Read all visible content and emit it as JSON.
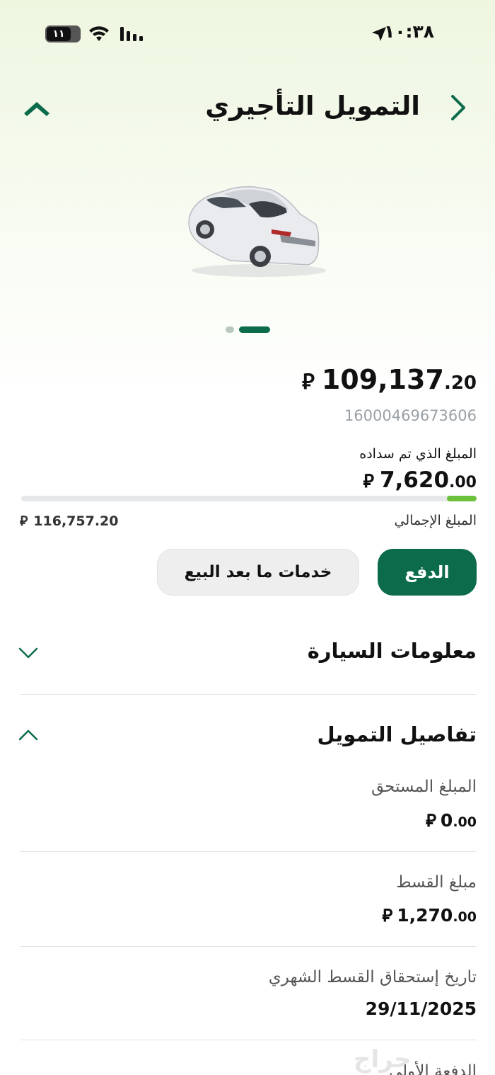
{
  "status_bar": {
    "time": "١٠:٣٨",
    "battery": "١١"
  },
  "header": {
    "title": "التمويل التأجيري"
  },
  "summary": {
    "remaining_int": "109,137",
    "remaining_dec": ".20",
    "currency_symbol": "⃁",
    "contract_number": "16000469673606",
    "paid_label": "المبلغ الذي تم سداده",
    "paid_int": "7,620",
    "paid_dec": ".00",
    "paid_fraction": 0.065,
    "total_label": "المبلغ الإجمالي",
    "total_amount": "116,757.20"
  },
  "buttons": {
    "pay": "الدفع",
    "after_sales": "خدمات ما بعد البيع"
  },
  "sections": {
    "car_info": "معلومات السيارة",
    "finance_details": "تفاصيل التمويل"
  },
  "finance": {
    "due_label": "المبلغ المستحق",
    "due_int": "0",
    "due_dec": ".00",
    "installment_label": "مبلغ القسط",
    "installment_int": "1,270",
    "installment_dec": ".00",
    "due_date_label": "تاريخ إستحقاق القسط الشهري",
    "due_date": "29/11/2025",
    "down_payment_label": "الدفعة الأولى"
  },
  "watermark": "حراج",
  "colors": {
    "primary": "#0b6b4b",
    "progress": "#6cc03b"
  },
  "icons": [
    "back-chevron-icon",
    "brand-logo-icon",
    "chevron-down-icon",
    "chevron-up-icon",
    "location-arrow-icon",
    "wifi-icon",
    "signal-icon",
    "battery-icon"
  ]
}
